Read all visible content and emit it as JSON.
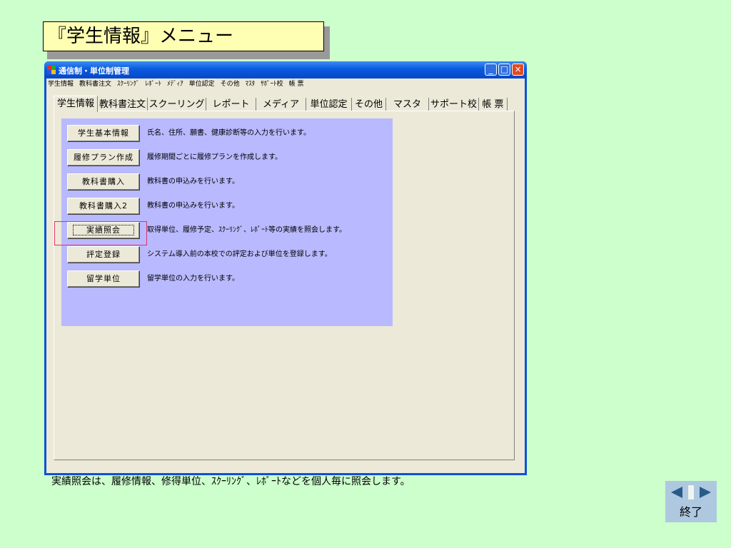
{
  "slide_title": "『学生情報』メニュー",
  "window": {
    "title": "通信制・単位制管理",
    "controls": [
      "_",
      "□",
      "×"
    ]
  },
  "menubar": [
    "学生情報",
    "教科書注文",
    "ｽｸｰﾘﾝｸﾞ",
    "ﾚﾎﾟｰﾄ",
    "ﾒﾃﾞｨｱ",
    "単位認定",
    "その他",
    "ﾏｽﾀ",
    "ｻﾎﾟｰﾄ校",
    "帳 票"
  ],
  "tabs": [
    "学生情報",
    "教科書注文",
    "スクーリング",
    "レポート",
    "メディア",
    "単位認定",
    "その他",
    "マスタ",
    "サポート校",
    "帳 票"
  ],
  "active_tab": "学生情報",
  "menu_buttons": [
    {
      "label": "学生基本情報",
      "description": "氏名、住所、願書、健康診断等の入力を行います。"
    },
    {
      "label": "履修プラン作成",
      "description": "履修期間ごとに履修プランを作成します。"
    },
    {
      "label": "教科書購入",
      "description": "教科書の申込みを行います。"
    },
    {
      "label": "教科書購入2",
      "description": "教科書の申込みを行います。"
    },
    {
      "label": "実績照会",
      "description": "取得単位、履修予定、ｽｸｰﾘﾝｸﾞ、ﾚﾎﾟｰﾄ等の実績を照会します。"
    },
    {
      "label": "評定登録",
      "description": "システム導入前の本校での評定および単位を登録します。"
    },
    {
      "label": "留学単位",
      "description": "留学単位の入力を行います。"
    }
  ],
  "highlighted_button": "実績照会",
  "caption": "実績照会は、履修情報、修得単位、ｽｸｰﾘﾝｸﾞ、ﾚﾎﾟｰﾄなどを個人毎に照会します。",
  "nav": {
    "end_label": "終了"
  },
  "colors": {
    "background": "#ccffcc",
    "title_box": "#ffffb3",
    "panel_blue": "#b9b9ff",
    "highlight": "#e0306a",
    "titlebar": "#0a5adf"
  }
}
